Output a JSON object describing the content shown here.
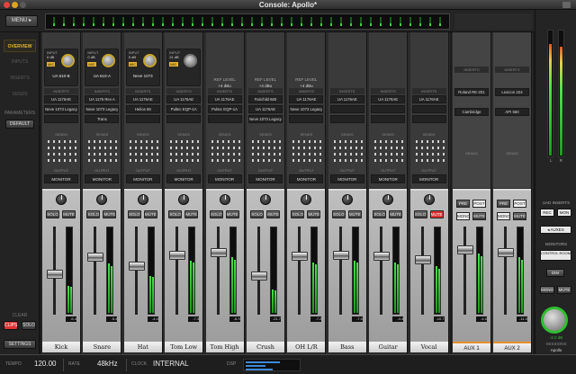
{
  "window": {
    "title": "Console: Apollo*"
  },
  "top": {
    "menu_label": "MENU"
  },
  "nav": {
    "items": [
      "OVERVIEW",
      "INPUTS",
      "INSERTS",
      "SENDS"
    ],
    "active": "OVERVIEW",
    "parameters_label": "PARAMETERS",
    "default_label": "DEFAULT",
    "clear_label": "CLEAR",
    "clips_label": "CLIPS",
    "solo_label": "SOLO",
    "settings_label": "SETTINGS"
  },
  "channels": [
    {
      "name": "Kick",
      "input_label": "INPUT",
      "gain": "0 dB",
      "mic": "MIC",
      "preamp": "UA 610-B",
      "inserts": [
        "UA 1176AE",
        "Neve 1073 Legacy",
        ""
      ],
      "sends": 4,
      "output": "OUTPUT",
      "monitor": "MONITOR",
      "peak": "-6.4",
      "solo": false,
      "mute": false,
      "meter": 0.32
    },
    {
      "name": "Snare",
      "input_label": "INPUT",
      "gain": "0 dB",
      "mic": "MIC",
      "preamp": "UA 610-A",
      "inserts": [
        "UA 1176 Rev A",
        "Neve 1073 Legacy",
        "Trans"
      ],
      "sends": 4,
      "output": "OUTPUT",
      "monitor": "MONITOR",
      "peak": "-5.4",
      "solo": false,
      "mute": false,
      "meter": 0.58
    },
    {
      "name": "Hat",
      "input_label": "INPUT",
      "gain": "0 dB",
      "mic": "MIC",
      "preamp": "Neve 1073",
      "inserts": [
        "UA 1176AE",
        "Helios 69",
        ""
      ],
      "sends": 4,
      "output": "OUTPUT",
      "monitor": "MONITOR",
      "peak": "-4.4",
      "solo": false,
      "mute": false,
      "meter": 0.44
    },
    {
      "name": "Tom Low",
      "input_label": "INPUT",
      "gain": "21 dB",
      "mic": "MIC",
      "preamp": "",
      "inserts": [
        "UA 1176AE",
        "Pultec EQP-1A",
        ""
      ],
      "sends": 4,
      "output": "OUTPUT",
      "monitor": "MONITOR",
      "peak": "-7.3",
      "solo": false,
      "mute": false,
      "meter": 0.62
    },
    {
      "name": "Tom High",
      "ref_level": "REF LEVEL",
      "level": "+4 dBu",
      "inserts": [
        "UA 1176AE",
        "Pultec EQP-1A",
        ""
      ],
      "sends": 4,
      "output": "OUTPUT",
      "monitor": "MONITOR",
      "peak": "-6.9",
      "solo": false,
      "mute": false,
      "meter": 0.66
    },
    {
      "name": "Crush",
      "ref_level": "REF LEVEL",
      "level": "+4 dBu",
      "inserts": [
        "Fairchild 660",
        "UA 1176AE",
        "Neve 1073 Legacy"
      ],
      "sends": 4,
      "output": "OUTPUT",
      "monitor": "MONITOR",
      "peak": "-21.7",
      "solo": false,
      "mute": false,
      "meter": 0.28
    },
    {
      "name": "OH L/R",
      "ref_level": "REF LEVEL",
      "level": "+4 dBu",
      "inserts": [
        "UA 1176AE",
        "Neve 1073 Legacy",
        ""
      ],
      "sends": 4,
      "output": "OUTPUT",
      "monitor": "MONITOR",
      "peak": "-7.2",
      "solo": false,
      "mute": false,
      "meter": 0.6
    },
    {
      "name": "Bass",
      "inserts": [
        "UA 1176AE",
        "",
        ""
      ],
      "sends": 4,
      "output": "OUTPUT",
      "monitor": "MONITOR",
      "peak": "-7.4",
      "solo": false,
      "mute": false,
      "meter": 0.62
    },
    {
      "name": "Guitar",
      "inserts": [
        "UA 1176AE",
        "",
        ""
      ],
      "sends": 4,
      "output": "OUTPUT",
      "monitor": "MONITOR",
      "peak": "-4.4",
      "solo": false,
      "mute": false,
      "meter": 0.6
    },
    {
      "name": "Vocal",
      "inserts": [
        "UA 1176AE",
        "",
        ""
      ],
      "sends": 4,
      "output": "OUTPUT",
      "monitor": "MONITOR",
      "peak": "-10.7",
      "solo": false,
      "mute": true,
      "meter": 0.55
    }
  ],
  "aux": [
    {
      "name": "AUX 1",
      "inserts_label": "INSERTS",
      "insert": "Roland RE-201",
      "insert2": "Cambridge",
      "sends_label": "SENDS",
      "pre": "PRE",
      "post": "POST",
      "mono": "MONO",
      "mute": "MUTE",
      "peak": "-4.0",
      "meter": 0.7
    },
    {
      "name": "AUX 2",
      "inserts_label": "INSERTS",
      "insert": "Lexicon 224",
      "insert2": "API 560",
      "sends_label": "SENDS",
      "pre": "PRE",
      "post": "POST",
      "mono": "MONO",
      "mute": "MUTE",
      "peak": "-11.0",
      "meter": 0.66
    }
  ],
  "monitor": {
    "uad_inserts_label": "UAD INSERTS",
    "rec": "REC",
    "mon": "MON",
    "auxes": "AUXES",
    "monitors_label": "MONITORS",
    "control_room": "CONTROL ROOM",
    "dim": "DIM",
    "mono": "MONO",
    "mute": "MUTE",
    "level": "-2.0 dB",
    "sessions_label": "SESSIONS",
    "session_name": "Apollo",
    "meter_l_label": "L",
    "meter_r_label": "R",
    "meter_l": 0.9,
    "meter_r": 0.88
  },
  "status": {
    "tempo_label": "TEMPO",
    "tempo": "120.00",
    "rate_label": "RATE",
    "rate": "48kHz",
    "clock_label": "CLOCK",
    "clock": "INTERNAL",
    "dsp_label": "DSP"
  },
  "labels": {
    "input": "INPUT",
    "inserts": "INSERTS",
    "sends": "SENDS",
    "solo": "SOLO",
    "mute": "MUTE"
  },
  "colors": {
    "accent": "#e8b630",
    "meter_green": "#3cd13c",
    "mute_red": "#d33333"
  }
}
